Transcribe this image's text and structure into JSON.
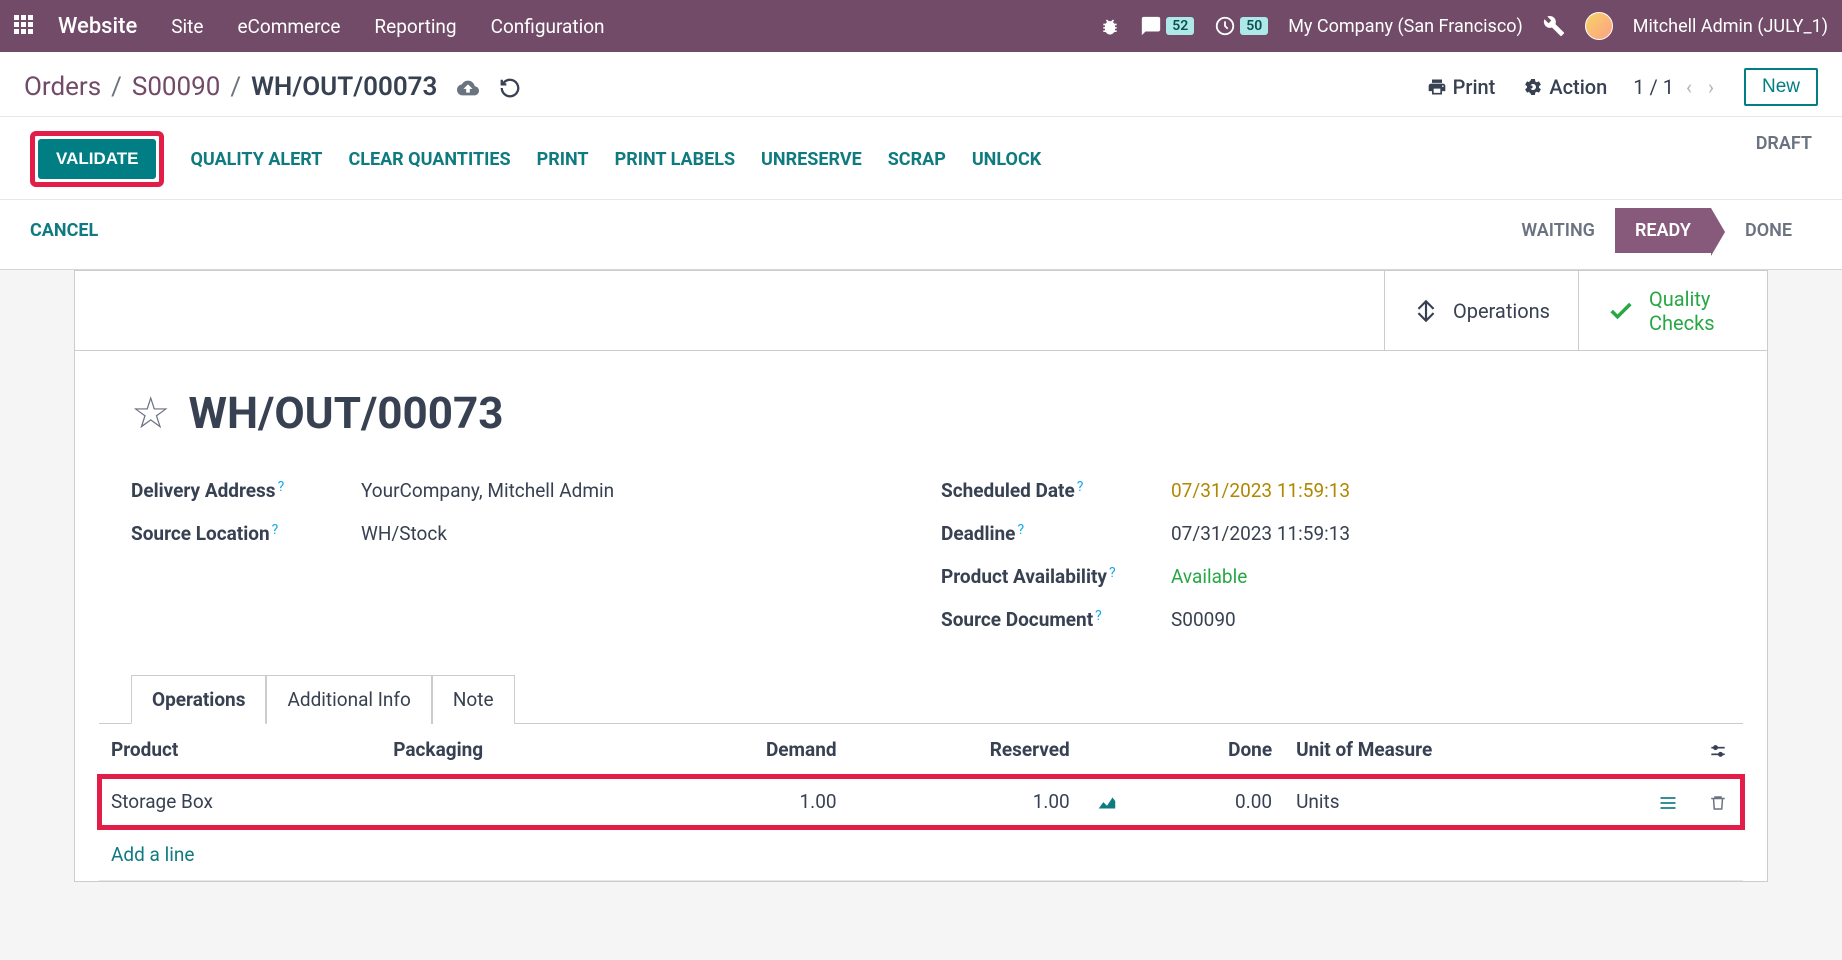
{
  "topnav": {
    "brand": "Website",
    "menu": [
      "Site",
      "eCommerce",
      "Reporting",
      "Configuration"
    ],
    "msg_badge": "52",
    "timer_badge": "50",
    "company": "My Company (San Francisco)",
    "user": "Mitchell Admin (JULY_1)"
  },
  "breadcrumb": {
    "root": "Orders",
    "mid": "S00090",
    "current": "WH/OUT/00073"
  },
  "topbar": {
    "print": "Print",
    "action": "Action",
    "pager": "1 / 1",
    "new": "New"
  },
  "actions": {
    "validate": "VALIDATE",
    "quality_alert": "QUALITY ALERT",
    "clear_quantities": "CLEAR QUANTITIES",
    "print": "PRINT",
    "print_labels": "PRINT LABELS",
    "unreserve": "UNRESERVE",
    "scrap": "SCRAP",
    "unlock": "UNLOCK",
    "cancel": "CANCEL"
  },
  "status": {
    "draft": "DRAFT",
    "waiting": "WAITING",
    "ready": "READY",
    "done": "DONE"
  },
  "sheet_btns": {
    "operations": "Operations",
    "quality_checks": "Quality Checks"
  },
  "record": {
    "title": "WH/OUT/00073",
    "delivery_address_label": "Delivery Address",
    "delivery_address": "YourCompany, Mitchell Admin",
    "source_location_label": "Source Location",
    "source_location": "WH/Stock",
    "scheduled_date_label": "Scheduled Date",
    "scheduled_date": "07/31/2023 11:59:13",
    "deadline_label": "Deadline",
    "deadline": "07/31/2023 11:59:13",
    "product_availability_label": "Product Availability",
    "product_availability": "Available",
    "source_document_label": "Source Document",
    "source_document": "S00090"
  },
  "tabs": {
    "operations": "Operations",
    "additional_info": "Additional Info",
    "note": "Note"
  },
  "table": {
    "headers": {
      "product": "Product",
      "packaging": "Packaging",
      "demand": "Demand",
      "reserved": "Reserved",
      "done": "Done",
      "uom": "Unit of Measure"
    },
    "rows": [
      {
        "product": "Storage Box",
        "packaging": "",
        "demand": "1.00",
        "reserved": "1.00",
        "done": "0.00",
        "uom": "Units"
      }
    ],
    "add_line": "Add a line"
  }
}
